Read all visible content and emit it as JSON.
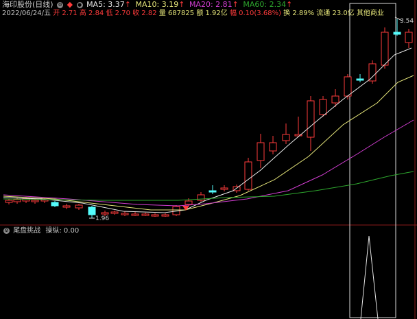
{
  "legend": {
    "title": "海印股份(日线)",
    "ma5": "MA5: 3.37",
    "ma10": "MA10: 3.19",
    "ma20": "MA20: 2.81",
    "ma60": "MA60: 2.34"
  },
  "info": {
    "date": "2022/06/24/五",
    "open": "开 2.71",
    "high": "高 2.84",
    "low": "低 2.70",
    "close": "收 2.82",
    "volume": "量 687825",
    "amount": "额 1.92亿",
    "change": "幅 0.10(3.68%)",
    "turnover": "换 2.89%",
    "float_cap": "流通 23.0亿",
    "sector": "其他商业"
  },
  "indicator": {
    "name": "尾盘挑战",
    "line": "操纵: 0.00"
  },
  "annotations": {
    "high_label": "3.54",
    "low_label": "1.96"
  },
  "colors": {
    "background": "#000000",
    "up": "#ff3b3b",
    "down": "#54fcfc",
    "ma5": "#e8e8e8",
    "ma10": "#e6e67a",
    "ma20": "#d23ed2",
    "ma60": "#2ea82e",
    "info_text": "#c8c8c8"
  },
  "chart_data": {
    "type": "candlestick",
    "price_labels": [
      "3.54",
      "1.96"
    ],
    "ma_lines": [
      "MA5",
      "MA10",
      "MA20",
      "MA60"
    ],
    "indicator": {
      "name": "操纵",
      "value": 0.0
    }
  }
}
